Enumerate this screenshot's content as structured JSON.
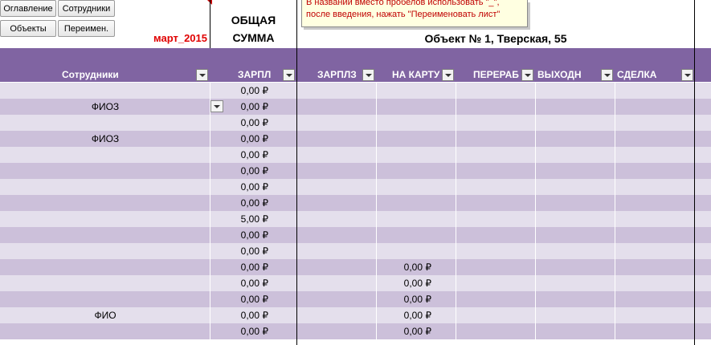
{
  "buttons": {
    "toc": "Оглавление",
    "employees": "Сотрудники",
    "objects": "Объекты",
    "rename": "Переимен."
  },
  "period": "март_2015",
  "total_title_line1": "ОБЩАЯ",
  "total_title_line2": "СУММА",
  "object_title": "Объект № 1, Тверская, 55",
  "note": {
    "line1": "В названии вместо пробелов использовать \"_\",",
    "line2": "после введения, нажать \"Переименовать лист\""
  },
  "columns": {
    "employees": "Сотрудники",
    "salary": "ЗАРПЛ",
    "salary_z": "ЗАРПЛЗ",
    "card": "НА КАРТУ",
    "overtime": "ПЕРЕРАБ",
    "days_off": "ВЫХОДН",
    "deal": "СДЕЛКА"
  },
  "rows": [
    {
      "name": "",
      "total": "0,00 ₽",
      "card": ""
    },
    {
      "name": "ФИОЗ",
      "total": "0,00 ₽",
      "card": ""
    },
    {
      "name": "",
      "total": "0,00 ₽",
      "card": ""
    },
    {
      "name": "ФИОЗ",
      "total": "0,00 ₽",
      "card": ""
    },
    {
      "name": "",
      "total": "0,00 ₽",
      "card": ""
    },
    {
      "name": "",
      "total": "0,00 ₽",
      "card": ""
    },
    {
      "name": "",
      "total": "0,00 ₽",
      "card": ""
    },
    {
      "name": "",
      "total": "0,00 ₽",
      "card": ""
    },
    {
      "name": "",
      "total": "5,00 ₽",
      "card": ""
    },
    {
      "name": "",
      "total": "0,00 ₽",
      "card": ""
    },
    {
      "name": "",
      "total": "0,00 ₽",
      "card": ""
    },
    {
      "name": "",
      "total": "0,00 ₽",
      "card": "0,00 ₽"
    },
    {
      "name": "",
      "total": "0,00 ₽",
      "card": "0,00 ₽"
    },
    {
      "name": "",
      "total": "0,00 ₽",
      "card": "0,00 ₽"
    },
    {
      "name": "ФИО",
      "total": "0,00 ₽",
      "card": "0,00 ₽"
    },
    {
      "name": "",
      "total": "0,00 ₽",
      "card": "0,00 ₽"
    }
  ],
  "colors": {
    "header": "#8064a2",
    "row_light": "#e4dfec",
    "row_dark": "#ccc0da",
    "period": "#e00000",
    "note_text": "#c00000",
    "note_bg": "#ffffe1"
  }
}
